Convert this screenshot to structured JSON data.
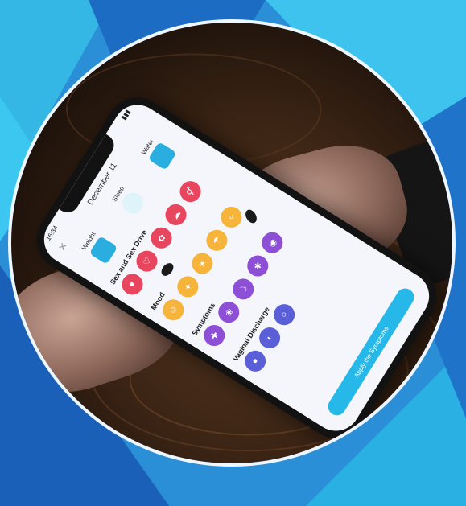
{
  "app": {
    "status_time": "16:34",
    "date": "December 11",
    "close_icon": "close-icon",
    "top_categories": [
      {
        "label": "Weight",
        "icon": "scale-icon"
      },
      {
        "label": "Sleep",
        "icon": "moon-icon"
      },
      {
        "label": "Water",
        "icon": "cup-icon"
      }
    ],
    "sections": [
      {
        "title": "Sex and Sex Drive",
        "color": "#e8455f",
        "items": [
          "♥",
          "♡",
          "✿",
          "☁",
          "⚥"
        ]
      },
      {
        "title": "Mood",
        "color": "#f6b43a",
        "items": [
          "☺",
          "✦",
          "☀",
          "☂",
          "✧"
        ]
      },
      {
        "title": "Symptoms",
        "color": "#8c4fd6",
        "items": [
          "✚",
          "❀",
          "☽",
          "✱",
          "◉"
        ]
      },
      {
        "title": "Vaginal Discharge",
        "color": "#5a5fd8",
        "items": [
          "●",
          "◐",
          "○"
        ]
      }
    ],
    "apply_label": "Apply the Symptoms"
  },
  "colors": {
    "background": "#2a8fd6",
    "accent_teal": "#25b8e8",
    "sex_red": "#e8455f",
    "mood_yellow": "#f6b43a",
    "symptoms_purple": "#8c4fd6"
  }
}
